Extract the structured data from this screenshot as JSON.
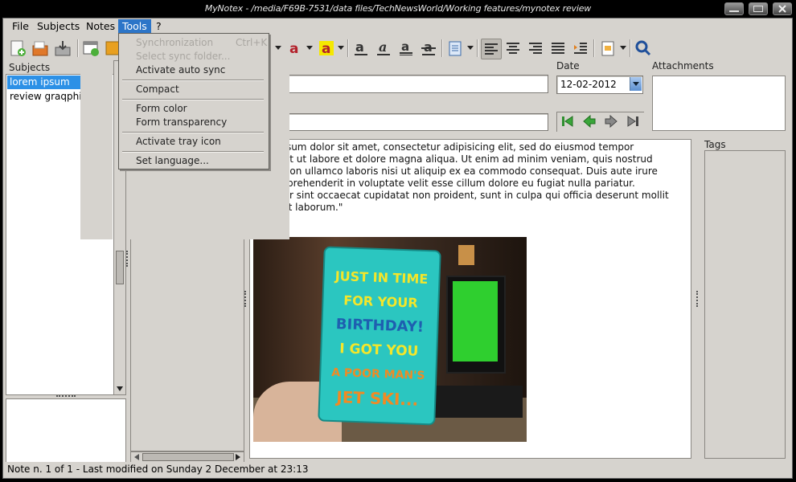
{
  "window": {
    "title": "MyNotex - /media/F69B-7531/data files/TechNewsWorld/Working features/mynotex review"
  },
  "menubar": {
    "items": [
      {
        "label": "File"
      },
      {
        "label": "Subjects"
      },
      {
        "label": "Notes"
      },
      {
        "label": "Tools"
      },
      {
        "label": "?"
      }
    ],
    "active": "Tools"
  },
  "tools_menu": {
    "synchronization": "Synchronization",
    "synchronization_shortcut": "Ctrl+K",
    "select_sync_folder": "Select sync folder...",
    "activate_auto_sync": "Activate auto sync",
    "compact": "Compact",
    "form_color": "Form color",
    "form_transparency": "Form transparency",
    "activate_tray_icon": "Activate tray icon",
    "set_language": "Set language..."
  },
  "subjects": {
    "header": "Subjects",
    "items": [
      {
        "label": "lorem ipsum",
        "selected": true
      },
      {
        "label": "review graqphics",
        "selected": false
      }
    ]
  },
  "note": {
    "date_label": "Date",
    "date_value": "12-02-2012",
    "attachments_label": "Attachments",
    "tags_label": "Tags",
    "body_lines": [
      "ipsum dolor sit amet, consectetur adipisicing elit, sed do eiusmod tempor",
      "unt ut labore et dolore magna aliqua. Ut enim ad minim veniam, quis nostrud",
      "ation ullamco laboris nisi ut aliquip ex ea commodo consequat. Duis aute irure",
      "reprehenderit in voluptate velit esse cillum dolore eu fugiat nulla pariatur.",
      "eur sint occaecat cupidatat non proident, sunt in culpa qui officia deserunt mollit",
      "est laborum.\""
    ],
    "image_card_text": [
      "JUST IN TIME",
      "FOR YOUR",
      "BIRTHDAY!",
      "I GOT YOU",
      "A POOR MAN'S",
      "JET SKI..."
    ]
  },
  "status": {
    "text": "Note n. 1 of 1 - Last modified on Sunday 2 December at 23:13"
  },
  "colors": {
    "accent": "#2c75c8",
    "selection": "#2c90e6",
    "chrome": "#d6d3ce",
    "nav_green": "#3aa63a"
  },
  "icons": [
    "new-note-icon",
    "open-folder-icon",
    "save-icon",
    "new-window-icon",
    "text-color-icon",
    "highlight-color-icon",
    "bold-icon",
    "italic-icon",
    "underline-icon",
    "strikethrough-icon",
    "bullet-list-icon",
    "align-left-icon",
    "align-center-icon",
    "align-right-icon",
    "justify-icon",
    "indent-icon",
    "insert-image-icon",
    "search-icon",
    "first-icon",
    "previous-icon",
    "next-icon",
    "last-icon"
  ]
}
